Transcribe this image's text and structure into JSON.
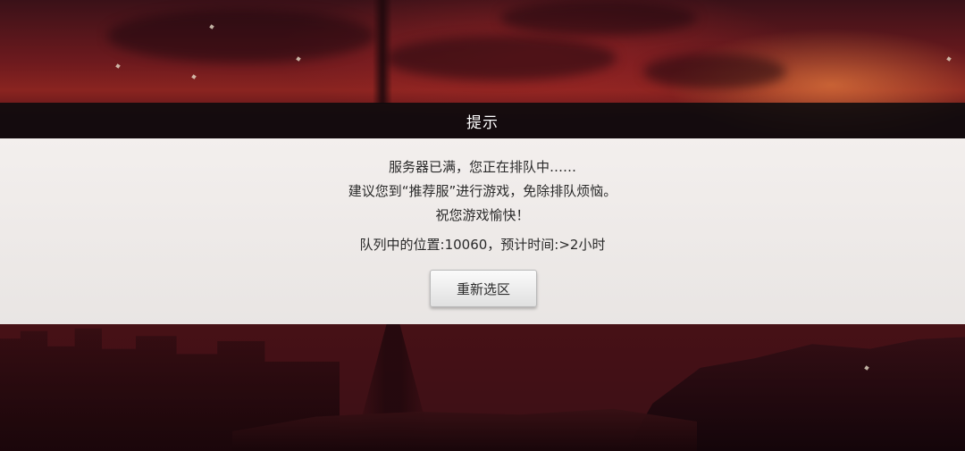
{
  "dialog": {
    "title": "提示",
    "message_lines": [
      "服务器已满，您正在排队中……",
      "建议您到“推荐服”进行游戏，免除排队烦恼。",
      "祝您游戏愉快！"
    ],
    "queue_status": "队列中的位置:10060，预计时间:>2小时",
    "reselect_button_label": "重新选区"
  }
}
